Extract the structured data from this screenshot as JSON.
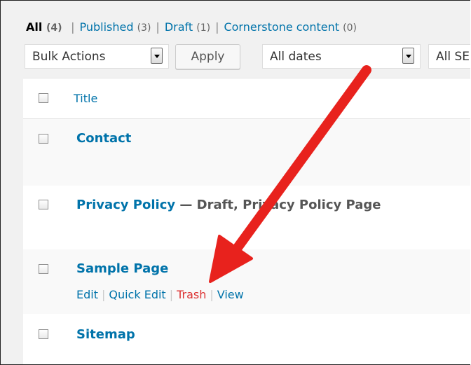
{
  "filters": {
    "all_label": "All",
    "all_count": "(4)",
    "published_label": "Published",
    "published_count": "(3)",
    "draft_label": "Draft",
    "draft_count": "(1)",
    "cornerstone_label": "Cornerstone content",
    "cornerstone_count": "(0)",
    "separator": "|"
  },
  "toolbar": {
    "bulk_actions": "Bulk Actions",
    "apply_label": "Apply",
    "dates": "All dates",
    "seo_filter": "All SE"
  },
  "table": {
    "title_header": "Title",
    "rows": [
      {
        "title": "Contact",
        "state": ""
      },
      {
        "title": "Privacy Policy",
        "state": " — Draft, Privacy Policy Page"
      },
      {
        "title": "Sample Page",
        "state": ""
      },
      {
        "title": "Sitemap",
        "state": ""
      }
    ],
    "row_actions": {
      "edit": "Edit",
      "quick_edit": "Quick Edit",
      "trash": "Trash",
      "view": "View",
      "pipe": "|"
    }
  },
  "colors": {
    "link": "#0073aa",
    "trash": "#dc3232",
    "annotation_arrow": "#e8221d"
  }
}
